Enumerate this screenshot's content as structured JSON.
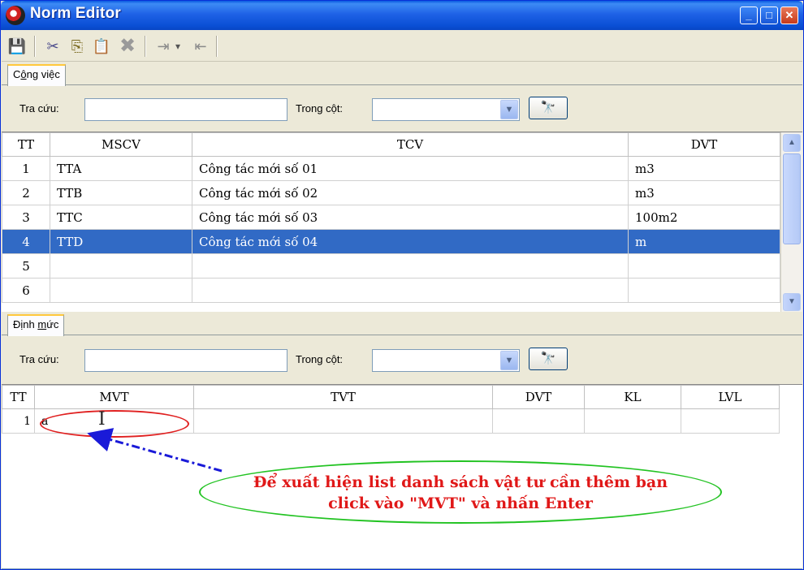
{
  "window": {
    "title": "Norm Editor",
    "minimize_glyph": "_",
    "maximize_glyph": "□",
    "close_glyph": "✕"
  },
  "toolbar": {
    "save_glyph": "💾",
    "cut_glyph": "✂",
    "copy_glyph": "⎘",
    "paste_glyph": "📋",
    "delete_glyph": "✖",
    "import_glyph": "⇥",
    "dropdown_glyph": "▾",
    "export_glyph": "⇤"
  },
  "tab_top": {
    "label_prefix": "C",
    "label_underline": "ô",
    "label_rest": "ng việc"
  },
  "search_top": {
    "lookup_label": "Tra cứu:",
    "lookup_value": "",
    "column_label": "Trong cột:",
    "column_value": "",
    "find_glyph": "🔭"
  },
  "grid_top": {
    "columns": [
      "TT",
      "MSCV",
      "TCV",
      "DVT"
    ],
    "rows": [
      {
        "tt": "1",
        "mscv": "TTA",
        "tcv": "Công tác mới số 01",
        "dvt": "m3"
      },
      {
        "tt": "2",
        "mscv": "TTB",
        "tcv": "Công tác mới số 02",
        "dvt": "m3"
      },
      {
        "tt": "3",
        "mscv": "TTC",
        "tcv": "Công tác mới số 03",
        "dvt": "100m2"
      },
      {
        "tt": "4",
        "mscv": "TTD",
        "tcv": "Công tác mới số 04",
        "dvt": "m"
      },
      {
        "tt": "5",
        "mscv": "",
        "tcv": "",
        "dvt": ""
      },
      {
        "tt": "6",
        "mscv": "",
        "tcv": "",
        "dvt": ""
      }
    ],
    "selected_index": 3,
    "scroll_up_glyph": "▲",
    "scroll_down_glyph": "▼"
  },
  "tab_bottom": {
    "label_prefix": "Định ",
    "label_underline": "m",
    "label_rest": "ức"
  },
  "search_bottom": {
    "lookup_label": "Tra cứu:",
    "lookup_value": "",
    "column_label": "Trong cột:",
    "column_value": "",
    "find_glyph": "🔭"
  },
  "grid_bottom": {
    "columns": [
      "TT",
      "MVT",
      "TVT",
      "DVT",
      "KL",
      "LVL"
    ],
    "rows": [
      {
        "tt": "1",
        "mvt": "a",
        "tvt": "",
        "dvt": "",
        "kl": "",
        "lvl": ""
      }
    ]
  },
  "annotation": {
    "line1": "Để xuất hiện list danh sách vật tư cần thêm bạn",
    "line2": "click vào \"MVT\" và nhấn Enter",
    "text_color": "#e01818",
    "bubble_color": "#22c322",
    "arrow_color": "#1a1ad8"
  },
  "colors": {
    "selection": "#316ac5",
    "titlebar": "#0a4fd5",
    "window_bg": "#ece9d8"
  }
}
